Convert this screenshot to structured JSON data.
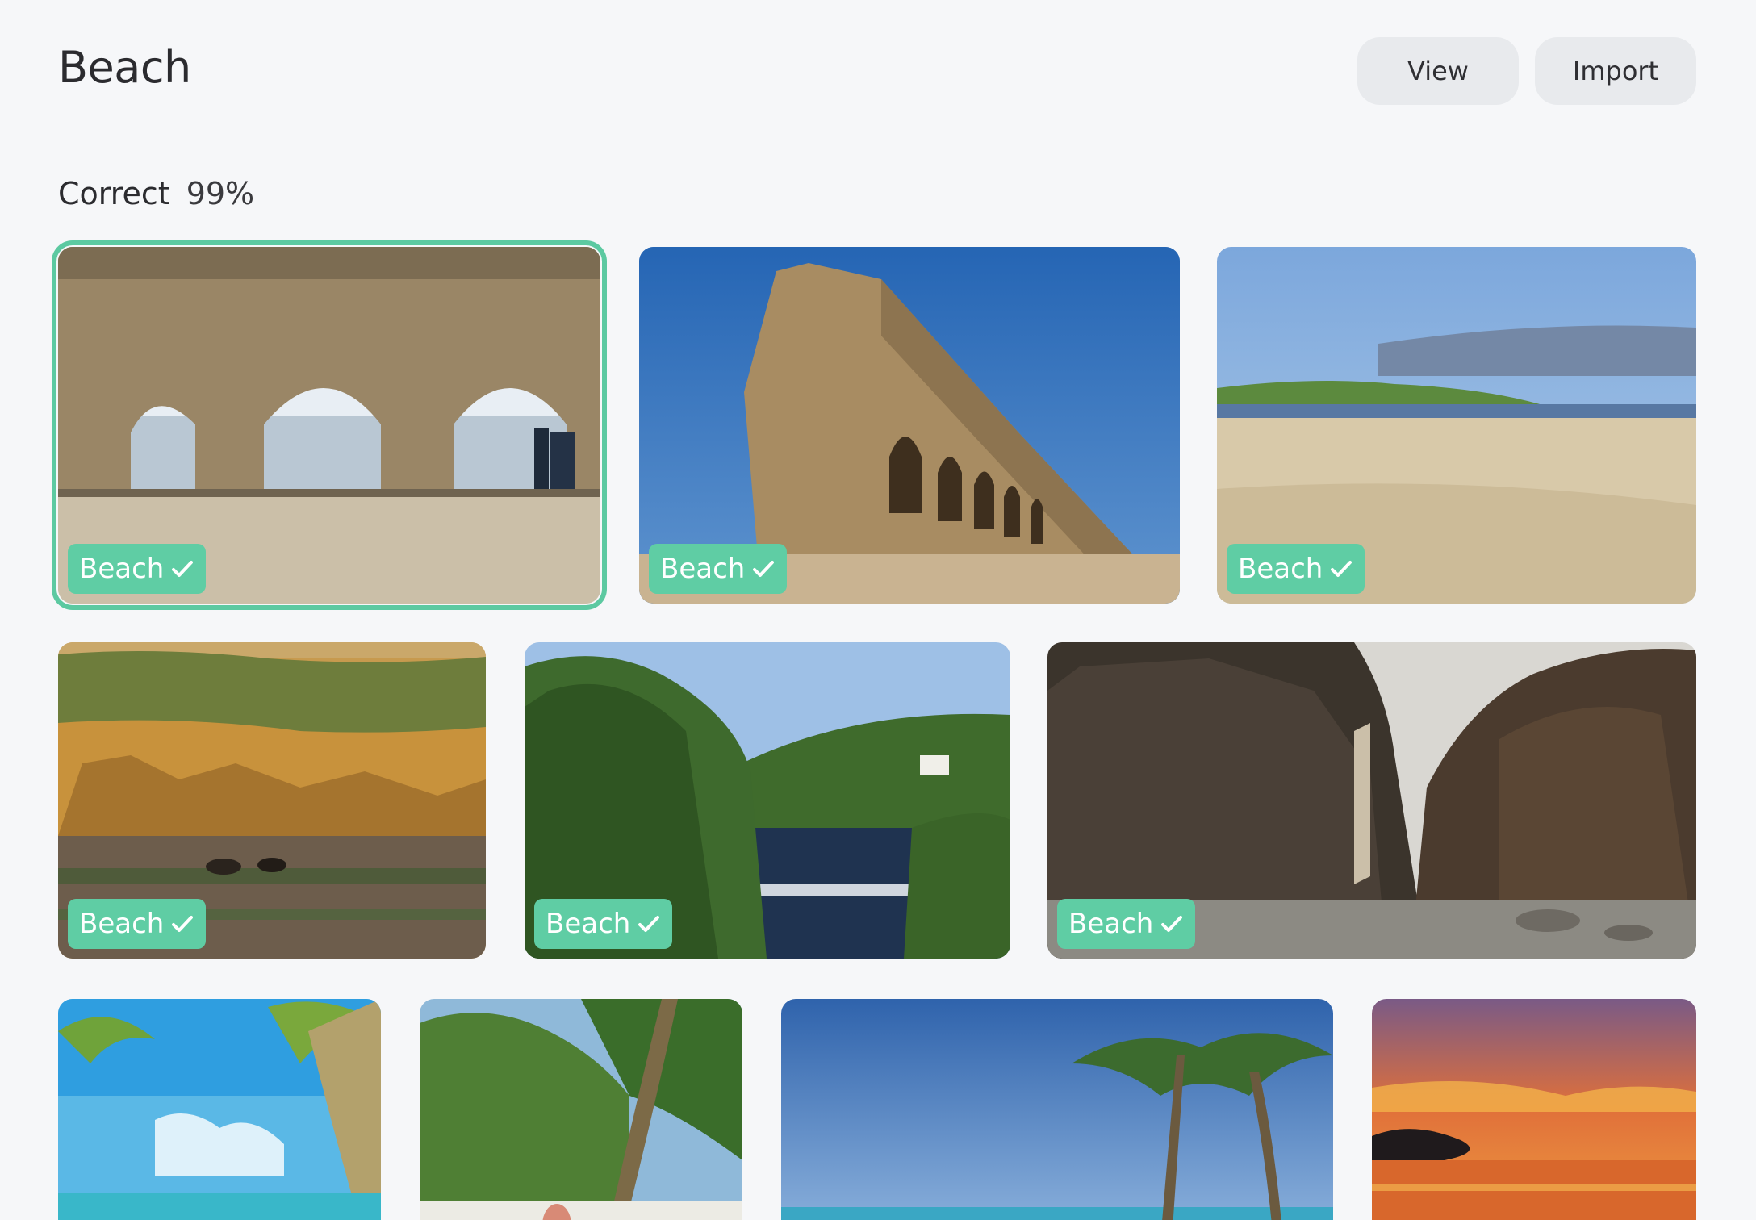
{
  "header": {
    "title": "Beach",
    "view_label": "View",
    "import_label": "Import"
  },
  "stats": {
    "label": "Correct",
    "value": "99%"
  },
  "colors": {
    "accent": "#5fcda4",
    "background": "#f6f7f9",
    "button_bg": "#e8eaed"
  },
  "cards": [
    {
      "tag": "Beach",
      "icon": "check-icon",
      "selected": true
    },
    {
      "tag": "Beach",
      "icon": "check-icon",
      "selected": false
    },
    {
      "tag": "Beach",
      "icon": "check-icon",
      "selected": false
    },
    {
      "tag": "Beach",
      "icon": "check-icon",
      "selected": false
    },
    {
      "tag": "Beach",
      "icon": "check-icon",
      "selected": false
    },
    {
      "tag": "Beach",
      "icon": "check-icon",
      "selected": false
    }
  ]
}
